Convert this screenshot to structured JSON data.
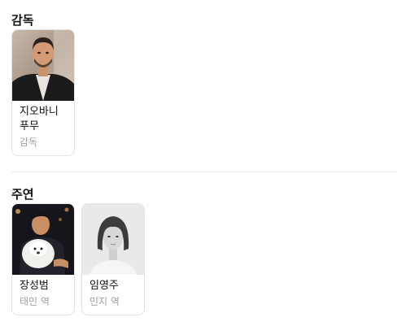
{
  "director_section": {
    "title": "감독",
    "people": [
      {
        "name": "지오바니 푸무",
        "role": "감독",
        "photo": "director-photo"
      }
    ]
  },
  "cast_section": {
    "title": "주연",
    "people": [
      {
        "name": "장성범",
        "role": "태민 역",
        "photo": "man-with-dog-photo"
      },
      {
        "name": "임영주",
        "role": "민지 역",
        "photo": "woman-portrait-photo"
      }
    ]
  }
}
